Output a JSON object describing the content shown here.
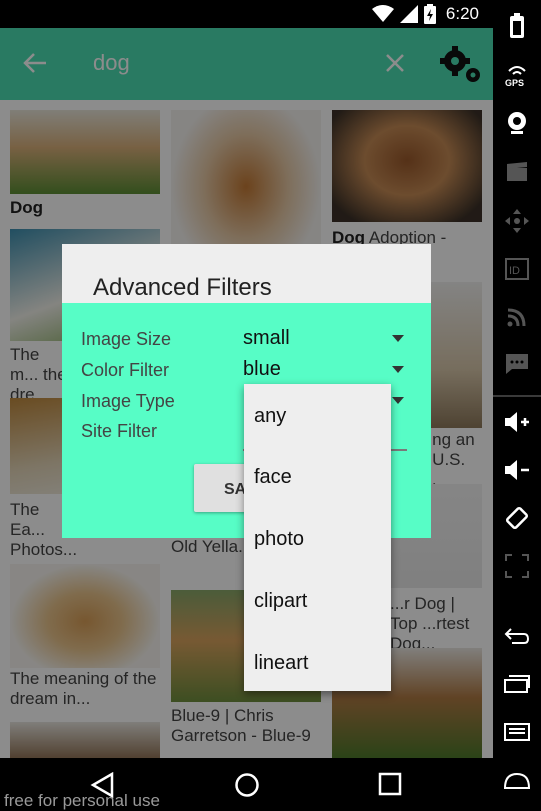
{
  "status_bar": {
    "time": "6:20"
  },
  "toolbar": {
    "query": "dog",
    "back_icon": "arrow-left-icon",
    "clear_icon": "close-icon",
    "settings_icon": "gear-icon"
  },
  "results": [
    {
      "caption_bold": "Dog",
      "caption": ""
    },
    {
      "caption_bold": "Dog",
      "caption": " Adoption -"
    },
    {
      "caption_bold": "",
      "caption": "The m... the dre..."
    },
    {
      "caption_bold": "",
      "caption": "...ng an ...U.S. |..."
    },
    {
      "caption_bold": "",
      "caption": "The Ea... Photos..."
    },
    {
      "caption_bold": "",
      "caption": "Old Yella... Ranch"
    },
    {
      "caption_bold": "",
      "caption": "The meaning of the dream in..."
    },
    {
      "caption_bold": "",
      "caption": "Blue-9 | Chris Garretson - Blue-9"
    },
    {
      "caption_bold": "Dog",
      "caption": "...r Dog | Top ...rtest Dog..."
    }
  ],
  "dialog": {
    "title": "Advanced Filters",
    "rows": [
      {
        "label": "Image Size",
        "value": "small"
      },
      {
        "label": "Color Filter",
        "value": "blue"
      },
      {
        "label": "Image Type",
        "value": ""
      },
      {
        "label": "Site Filter",
        "value": ""
      }
    ],
    "save_label": "SA"
  },
  "dropdown": {
    "options": [
      "any",
      "face",
      "photo",
      "clipart",
      "lineart"
    ]
  },
  "watermark": "free for personal use",
  "colors": {
    "accent": "#4cdfb3",
    "dialog_body": "#57fdc6",
    "dialog_header": "#eeeeee"
  }
}
